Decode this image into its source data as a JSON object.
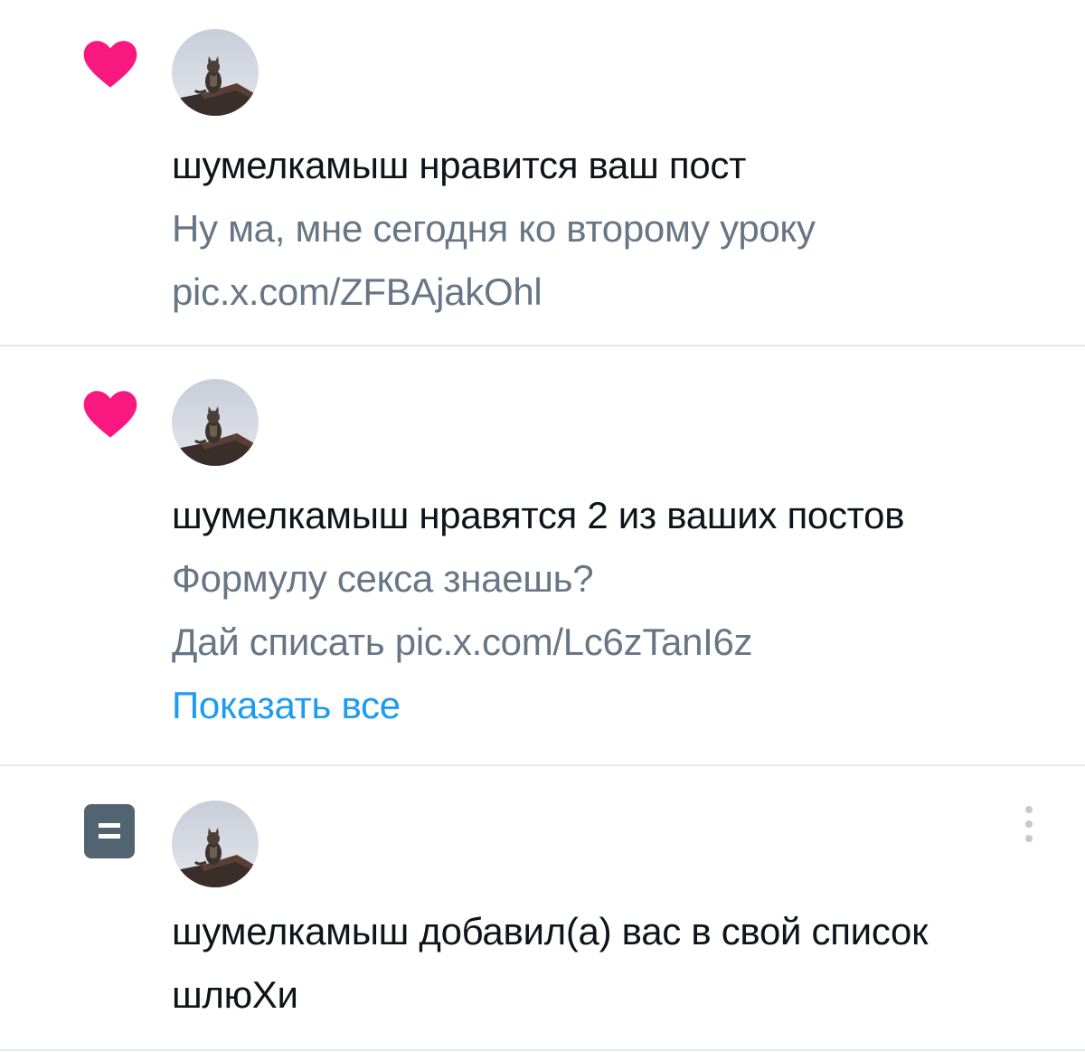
{
  "notifications": [
    {
      "type_icon": "heart-icon",
      "user": "шумелкамыш",
      "action": "нравится ваш пост",
      "preview_line1": "Ну ма, мне сегодня ко второму уроку",
      "preview_line2": "pic.x.com/ZFBAjakOhl"
    },
    {
      "type_icon": "heart-icon",
      "user": "шумелкамыш",
      "action": "нравятся 2 из ваших постов",
      "preview_line1": "Формулу секса знаешь?",
      "preview_line2": "Дай списать pic.x.com/Lc6zTanI6z",
      "show_all": "Показать все"
    },
    {
      "type_icon": "list-icon",
      "user": "шумелкамыш",
      "action": "добавил(а) вас в свой список",
      "list_name": "шлюХи"
    }
  ],
  "colors": {
    "heart": "#f91880",
    "list_icon_bg": "#536471",
    "link": "#1d9bf0",
    "secondary_text": "#687684",
    "primary_text": "#0f1419",
    "divider": "#e6e9ec"
  }
}
